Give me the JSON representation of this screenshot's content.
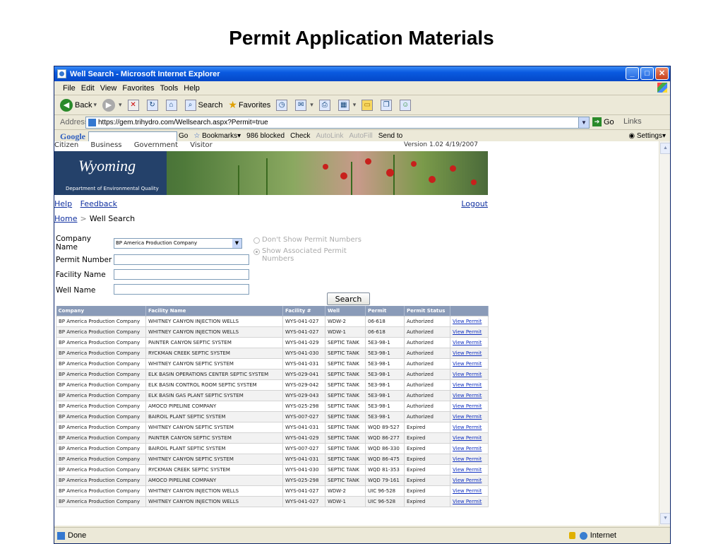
{
  "slide_title": "Permit Application Materials",
  "window": {
    "title": "Well Search - Microsoft Internet Explorer"
  },
  "menu": [
    "File",
    "Edit",
    "View",
    "Favorites",
    "Tools",
    "Help"
  ],
  "toolbar": {
    "back": "Back",
    "search": "Search",
    "favorites": "Favorites"
  },
  "address": {
    "label": "Address",
    "url": "https://gem.trihydro.com/Wellsearch.aspx?Permit=true",
    "go": "Go",
    "links": "Links"
  },
  "google_bar": {
    "logo": "Google",
    "go": "Go",
    "bookmarks": "Bookmarks",
    "blocked": "986 blocked",
    "check": "Check",
    "autolink": "AutoLink",
    "autofill": "AutoFill",
    "send_to": "Send to",
    "settings": "Settings"
  },
  "site": {
    "topnav": [
      "Citizen",
      "Business",
      "Government",
      "Visitor"
    ],
    "version": "Version 1.02 4/19/2007",
    "logo_text": "Wyoming",
    "dept": "Department of Environmental Quality",
    "links": {
      "help": "Help",
      "feedback": "Feedback",
      "logout": "Logout"
    },
    "breadcrumb": {
      "home": "Home",
      "sep": ">",
      "current": "Well Search"
    }
  },
  "form": {
    "company_label": "Company Name",
    "company_value": "BP America Production Company",
    "permit_label": "Permit Number",
    "facility_label": "Facility Name",
    "well_label": "Well Name",
    "radio_hide": "Don't Show Permit Numbers",
    "radio_show": "Show Associated Permit Numbers",
    "search_button": "Search"
  },
  "table": {
    "columns": [
      "Company",
      "Facility Name",
      "Facility #",
      "Well",
      "Permit",
      "Permit Status",
      ""
    ],
    "link_label": "View Permit",
    "rows": [
      [
        "BP America Production Company",
        "WHITNEY CANYON INJECTION WELLS",
        "WYS-041-027",
        "WDW-2",
        "06-618",
        "Authorized"
      ],
      [
        "BP America Production Company",
        "WHITNEY CANYON INJECTION WELLS",
        "WYS-041-027",
        "WDW-1",
        "06-618",
        "Authorized"
      ],
      [
        "BP America Production Company",
        "PAINTER CANYON SEPTIC SYSTEM",
        "WYS-041-029",
        "SEPTIC TANK",
        "5E3-98-1",
        "Authorized"
      ],
      [
        "BP America Production Company",
        "RYCKMAN CREEK SEPTIC SYSTEM",
        "WYS-041-030",
        "SEPTIC TANK",
        "5E3-98-1",
        "Authorized"
      ],
      [
        "BP America Production Company",
        "WHITNEY CANYON SEPTIC SYSTEM",
        "WYS-041-031",
        "SEPTIC TANK",
        "5E3-98-1",
        "Authorized"
      ],
      [
        "BP America Production Company",
        "ELK BASIN OPERATIONS CENTER SEPTIC SYSTEM",
        "WYS-029-041",
        "SEPTIC TANK",
        "5E3-98-1",
        "Authorized"
      ],
      [
        "BP America Production Company",
        "ELK BASIN CONTROL ROOM SEPTIC SYSTEM",
        "WYS-029-042",
        "SEPTIC TANK",
        "5E3-98-1",
        "Authorized"
      ],
      [
        "BP America Production Company",
        "ELK BASIN GAS PLANT SEPTIC SYSTEM",
        "WYS-029-043",
        "SEPTIC TANK",
        "5E3-98-1",
        "Authorized"
      ],
      [
        "BP America Production Company",
        "AMOCO PIPELINE COMPANY",
        "WYS-025-298",
        "SEPTIC TANK",
        "5E3-98-1",
        "Authorized"
      ],
      [
        "BP America Production Company",
        "BAIROIL PLANT SEPTIC SYSTEM",
        "WYS-007-027",
        "SEPTIC TANK",
        "5E3-98-1",
        "Authorized"
      ],
      [
        "BP America Production Company",
        "WHITNEY CANYON SEPTIC SYSTEM",
        "WYS-041-031",
        "SEPTIC TANK",
        "WQD 89-527",
        "Expired"
      ],
      [
        "BP America Production Company",
        "PAINTER CANYON SEPTIC SYSTEM",
        "WYS-041-029",
        "SEPTIC TANK",
        "WQD 86-277",
        "Expired"
      ],
      [
        "BP America Production Company",
        "BAIROIL PLANT SEPTIC SYSTEM",
        "WYS-007-027",
        "SEPTIC TANK",
        "WQD 86-330",
        "Expired"
      ],
      [
        "BP America Production Company",
        "WHITNEY CANYON SEPTIC SYSTEM",
        "WYS-041-031",
        "SEPTIC TANK",
        "WQD 86-475",
        "Expired"
      ],
      [
        "BP America Production Company",
        "RYCKMAN CREEK SEPTIC SYSTEM",
        "WYS-041-030",
        "SEPTIC TANK",
        "WQD 81-353",
        "Expired"
      ],
      [
        "BP America Production Company",
        "AMOCO PIPELINE COMPANY",
        "WYS-025-298",
        "SEPTIC TANK",
        "WQD 79-161",
        "Expired"
      ],
      [
        "BP America Production Company",
        "WHITNEY CANYON INJECTION WELLS",
        "WYS-041-027",
        "WDW-2",
        "UIC 96-528",
        "Expired"
      ],
      [
        "BP America Production Company",
        "WHITNEY CANYON INJECTION WELLS",
        "WYS-041-027",
        "WDW-1",
        "UIC 96-528",
        "Expired"
      ]
    ]
  },
  "status": {
    "left": "Done",
    "right": "Internet"
  }
}
